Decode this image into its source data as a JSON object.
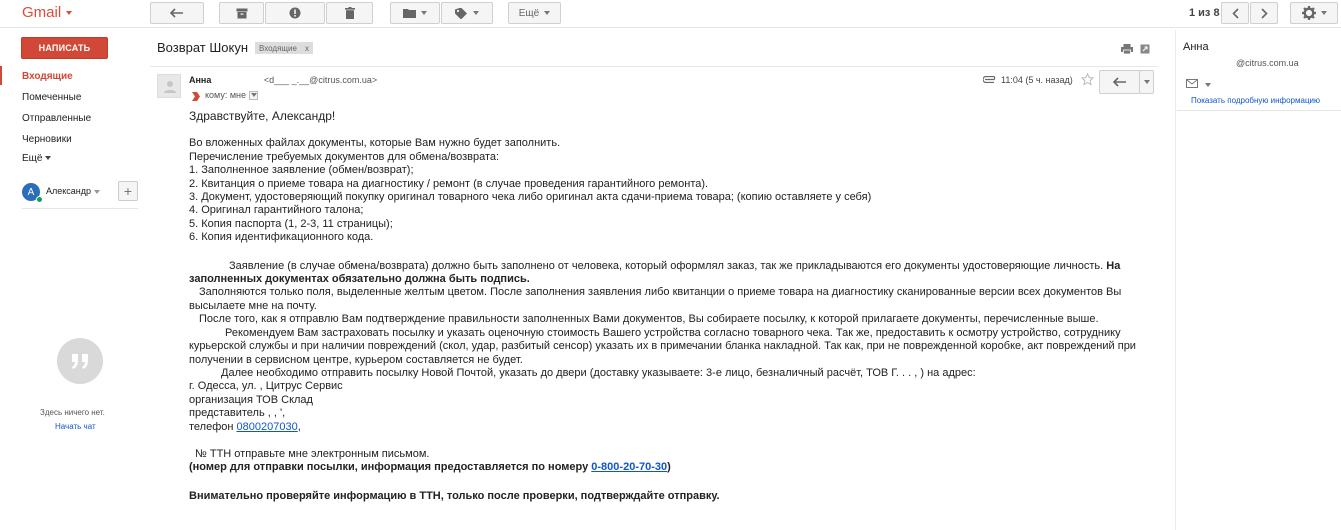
{
  "app": {
    "logo": "Gmail"
  },
  "toolbar": {
    "more_label": "Ещё",
    "pager": "1 из 8"
  },
  "sidebar": {
    "compose_label": "НАПИСАТЬ",
    "items": [
      {
        "label": "Входящие"
      },
      {
        "label": "Помеченные"
      },
      {
        "label": "Отправленные"
      },
      {
        "label": "Черновики"
      },
      {
        "label": "Ещё"
      }
    ],
    "user": {
      "initial": "А",
      "name": "Александр"
    },
    "chat_empty": "Здесь ничего нет.",
    "chat_start": "Начать чат"
  },
  "message": {
    "subject": "Возврат Шокун",
    "label": "Входящие",
    "label_close": "x",
    "sender_name": "Анна ",
    "sender_email": "<d___  _.__@citrus.com.ua>",
    "to_line": "кому: мне",
    "time": "11:04 (5 ч. назад)",
    "body": {
      "greeting": "Здравствуйте, Александр!",
      "intro": "Во вложенных файлах документы,  которые Вам нужно будет заполнить.",
      "list_title": "Перечисление требуемых документов для обмена/возврата:",
      "items": [
        "1. Заполненное заявление (обмен/возврат);",
        "2. Квитанция о приеме товара на диагностику / ремонт (в случае проведения гарантийного ремонта).",
        "3. Документ, удостоверяющий покупку оригинал товарного чека либо оригинал акта сдачи-приема товара; (копию оставляете у себя)",
        "4. Оригинал гарантийного талона;",
        "5. Копия паспорта (1, 2-3, 11 страницы);",
        "6. Копия идентификационного кода."
      ],
      "para1": "Заявление (в случае обмена/возврата) должно быть заполнено от человека, который оформлял заказ, так же прикладываются его документы удостоверяющие личность.",
      "para1_bold": "На заполненных документах обязательно должна быть подпись.",
      "para2": "Заполняются только поля, выделенные желтым цветом.    После заполнения заявления либо квитанции о приеме товара на диагностику сканированные версии всех документов Вы  высылаете мне на почту.",
      "para3": "После того, как я отправлю Вам подтверждение правильности заполненных Вами документов, Вы собираете посылку, к которой прилагаете документы, перечисленные выше.",
      "para4": "Рекомендуем Вам застраховать посылку и указать оценочную стоимость Вашего устройства согласно товарного чека. Так же, предоставить к осмотру устройство, сотруднику курьерской службы и при наличии повреждений (скол, удар, разбитый сенсор) указать их в примечании бланка накладной. Так как, при не поврежденной коробке, акт повреждений при получении в сервисном центре, курьером составляется не будет.",
      "para5": "Далее необходимо отправить посылку Новой Почтой, указать до двери (доставку указываете: 3-е лицо, безналичный расчёт, ТОВ Г. .  . ,      )  на адрес:",
      "addr1": "г. Одесса, ул.                         ,       Цитрус Сервис",
      "addr2": "организация              ТОВ Склад",
      "addr3": "представитель          ,  ,      ',",
      "phone_label": "телефон ",
      "phone": "0800207030",
      "phone_suffix": ",",
      "ttn": "№ ТТН отправьте мне электронным письмом.",
      "ttn_bold": "(номер для отправки посылки, информация предоставляется по номеру ",
      "ttn_phone": "0-800-20-70-30",
      "ttn_close": ")",
      "warn": "Внимательно проверяйте информацию в ТТН, только после проверки, подтверждайте отправку."
    }
  },
  "contact_panel": {
    "name": "Анна",
    "email": "@citrus.com.ua",
    "details_link": "Показать подробную информацию"
  },
  "colors": {
    "accent": "#d14836",
    "link": "#1155cc",
    "logo": "#dd4b39"
  }
}
